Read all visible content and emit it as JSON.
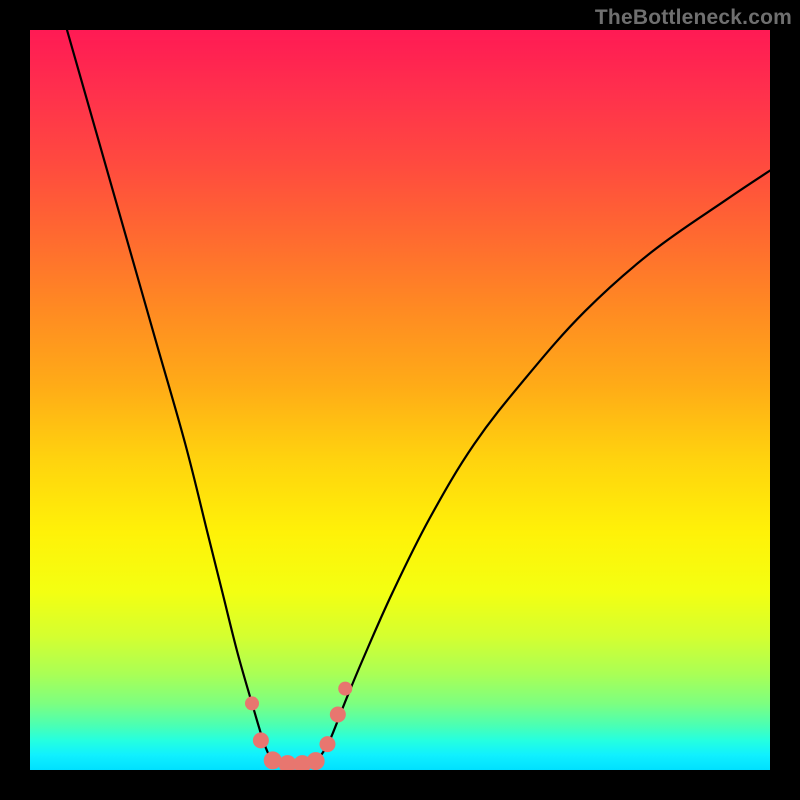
{
  "watermark": "TheBottleneck.com",
  "chart_data": {
    "type": "line",
    "title": "",
    "xlabel": "",
    "ylabel": "",
    "xlim": [
      0,
      100
    ],
    "ylim": [
      0,
      100
    ],
    "grid": false,
    "legend": false,
    "series": [
      {
        "name": "left-branch",
        "x": [
          5,
          9,
          13,
          17,
          21,
          24,
          26,
          28,
          30,
          31.5,
          32.5
        ],
        "y": [
          100,
          86,
          72,
          58,
          44,
          32,
          24,
          16,
          9,
          4,
          1.5
        ]
      },
      {
        "name": "right-branch",
        "x": [
          39,
          40.5,
          42.5,
          45,
          49,
          54,
          60,
          67,
          75,
          84,
          94,
          100
        ],
        "y": [
          1.5,
          4,
          9,
          15,
          24,
          34,
          44,
          53,
          62,
          70,
          77,
          81
        ]
      },
      {
        "name": "floor-segment",
        "x": [
          32.5,
          34,
          36,
          38,
          39
        ],
        "y": [
          1.5,
          0.8,
          0.6,
          0.8,
          1.5
        ]
      }
    ],
    "markers": {
      "name": "highlighted-points",
      "color": "#e8766f",
      "points": [
        {
          "x": 30.0,
          "y": 9.0,
          "r": 7
        },
        {
          "x": 31.2,
          "y": 4.0,
          "r": 8
        },
        {
          "x": 32.8,
          "y": 1.3,
          "r": 9
        },
        {
          "x": 34.8,
          "y": 0.8,
          "r": 9
        },
        {
          "x": 36.8,
          "y": 0.8,
          "r": 9
        },
        {
          "x": 38.6,
          "y": 1.2,
          "r": 9
        },
        {
          "x": 40.2,
          "y": 3.5,
          "r": 8
        },
        {
          "x": 41.6,
          "y": 7.5,
          "r": 8
        },
        {
          "x": 42.6,
          "y": 11.0,
          "r": 7
        }
      ]
    },
    "curve_color": "#000000",
    "curve_width": 2.2
  }
}
